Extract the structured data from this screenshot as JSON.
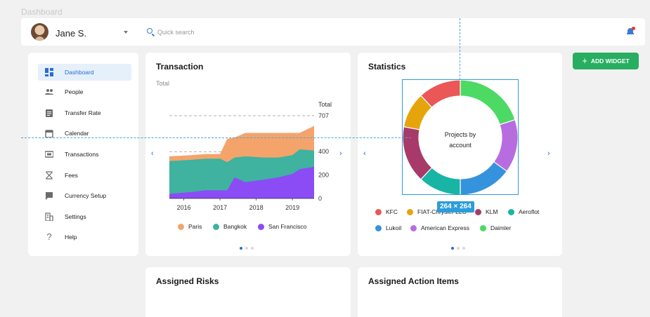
{
  "frame_label": "Dashboard",
  "user": {
    "name": "Jane S."
  },
  "search": {
    "placeholder": "Quick search"
  },
  "sidebar": {
    "items": [
      {
        "label": "Dashboard",
        "icon": "dashboard-icon",
        "active": true
      },
      {
        "label": "People",
        "icon": "people-icon"
      },
      {
        "label": "Transfer Rate",
        "icon": "clipboard-icon"
      },
      {
        "label": "Calendar",
        "icon": "calendar-icon"
      },
      {
        "label": "Transactions",
        "icon": "transactions-icon"
      },
      {
        "label": "Fees",
        "icon": "hourglass-icon"
      },
      {
        "label": "Currency Setup",
        "icon": "chat-icon"
      },
      {
        "label": "Settings",
        "icon": "building-icon"
      },
      {
        "label": "Help",
        "icon": "help-icon"
      }
    ]
  },
  "add_widget": {
    "label": "ADD WIDGET"
  },
  "transaction": {
    "title": "Transaction",
    "subtitle": "Total",
    "axis_label": "Total",
    "y_ticks": [
      "707",
      "400",
      "200",
      "0"
    ],
    "x_ticks": [
      "2016",
      "2017",
      "2018",
      "2019"
    ],
    "legend": [
      {
        "label": "Paris",
        "color": "#f4a46b"
      },
      {
        "label": "Bangkok",
        "color": "#3fb2a0"
      },
      {
        "label": "San Francisco",
        "color": "#8b4cf5"
      }
    ]
  },
  "statistics": {
    "title": "Statistics",
    "center_text": "Projects by account",
    "legend": [
      {
        "label": "KFC",
        "color": "#eb5757"
      },
      {
        "label": "FIAT-Chrysler LLC",
        "color": "#e5a50a"
      },
      {
        "label": "KLM",
        "color": "#a83a6a"
      },
      {
        "label": "Aeroflot",
        "color": "#18b4a4"
      },
      {
        "label": "Lukoil",
        "color": "#3593dd"
      },
      {
        "label": "American Express",
        "color": "#b76de0"
      },
      {
        "label": "Daimler",
        "color": "#4cd964"
      }
    ]
  },
  "selection_badge": "264 × 264",
  "assigned_risks": {
    "title": "Assigned Risks"
  },
  "assigned_actions": {
    "title": "Assigned Action Items"
  },
  "chart_data": [
    {
      "type": "area",
      "title": "Transaction",
      "ylabel": "Total",
      "ylim": [
        0,
        707
      ],
      "x_ticks": [
        "2016",
        "2017",
        "2018",
        "2019"
      ],
      "x": [
        2015.6,
        2016.2,
        2016.6,
        2017.0,
        2017.2,
        2017.4,
        2017.7,
        2018.2,
        2018.6,
        2019.0,
        2019.2,
        2019.6
      ],
      "series": [
        {
          "name": "San Francisco",
          "values": [
            40,
            55,
            70,
            70,
            70,
            180,
            140,
            160,
            180,
            210,
            250,
            270
          ]
        },
        {
          "name": "Bangkok",
          "values": [
            320,
            330,
            340,
            340,
            310,
            350,
            360,
            350,
            350,
            370,
            420,
            410
          ]
        },
        {
          "name": "Paris",
          "values": [
            360,
            370,
            380,
            380,
            510,
            520,
            560,
            560,
            560,
            560,
            560,
            620
          ]
        }
      ],
      "grid_lines": [
        707,
        400
      ]
    },
    {
      "type": "pie",
      "title": "Projects by account",
      "categories": [
        "Daimler",
        "American Express",
        "Lukoil",
        "Aeroflot",
        "KLM",
        "FIAT-Chrysler LLC",
        "KFC"
      ],
      "values": [
        20,
        15,
        15,
        12,
        16,
        10,
        12
      ]
    }
  ]
}
